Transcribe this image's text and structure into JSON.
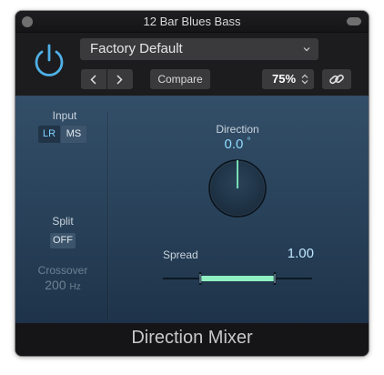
{
  "window": {
    "title": "12 Bar Blues Bass"
  },
  "header": {
    "preset": "Factory Default",
    "compare_label": "Compare",
    "zoom": "75%"
  },
  "panel": {
    "input": {
      "label": "Input",
      "options": [
        "LR",
        "MS"
      ],
      "selected": "LR"
    },
    "split": {
      "label": "Split",
      "value": "OFF"
    },
    "crossover": {
      "label": "Crossover",
      "value": "200",
      "unit": "Hz"
    },
    "direction": {
      "label": "Direction",
      "value": "0.0",
      "unit": "°"
    },
    "spread": {
      "label": "Spread",
      "value": "1.00",
      "min": 0,
      "max": 2
    }
  },
  "footer": {
    "plugin_name": "Direction Mixer"
  },
  "colors": {
    "accent": "#4fb0e6",
    "spread_fill": "#8ff0c2",
    "panel_top": "#334e68",
    "panel_bottom": "#1e3349"
  }
}
